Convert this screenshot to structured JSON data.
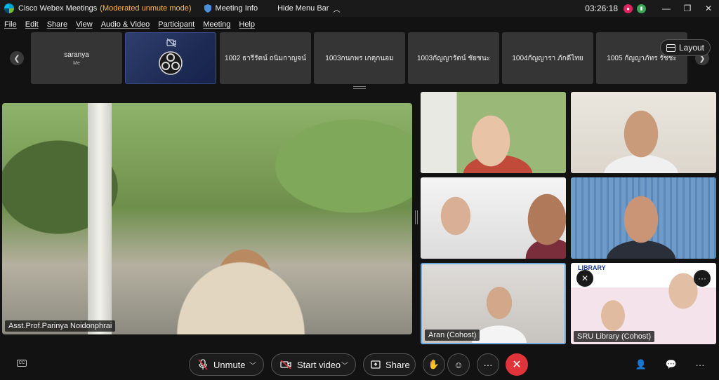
{
  "titlebar": {
    "app_name": "Cisco Webex Meetings",
    "mode": "(Moderated unmute mode)",
    "meeting_info": "Meeting Info",
    "hide_menu": "Hide Menu Bar",
    "time": "03:26:18"
  },
  "menu": [
    "File",
    "Edit",
    "Share",
    "View",
    "Audio & Video",
    "Participant",
    "Meeting",
    "Help"
  ],
  "filmstrip": {
    "tiles": [
      {
        "name": "saranya",
        "sub": "Me"
      },
      {
        "name": "1002 ธารีรัตน์ ถนิมกาญจน์"
      },
      {
        "name": "1003กนกพร เกตุกนอม"
      },
      {
        "name": "1003กัญญารัตน์ ชัยชนะ"
      },
      {
        "name": "1004กัญญารา ภักดีไทย"
      },
      {
        "name": "1005 กัญญาภัทร รัชชะ"
      }
    ],
    "layout_label": "Layout"
  },
  "main_video": {
    "name": "Asst.Prof.Parinya Noidonphrai"
  },
  "grid": {
    "tile5_name": "Aran  (Cohost)",
    "tile6_name": "SRU Library (Cohost)",
    "tile6_slide_title": "LIBRARY"
  },
  "controls": {
    "unmute": "Unmute",
    "start_video": "Start video",
    "share": "Share"
  },
  "colors": {
    "accent_mode": "#ffb74d",
    "end_call": "#e0343a",
    "active_border": "#6fa8dc"
  }
}
